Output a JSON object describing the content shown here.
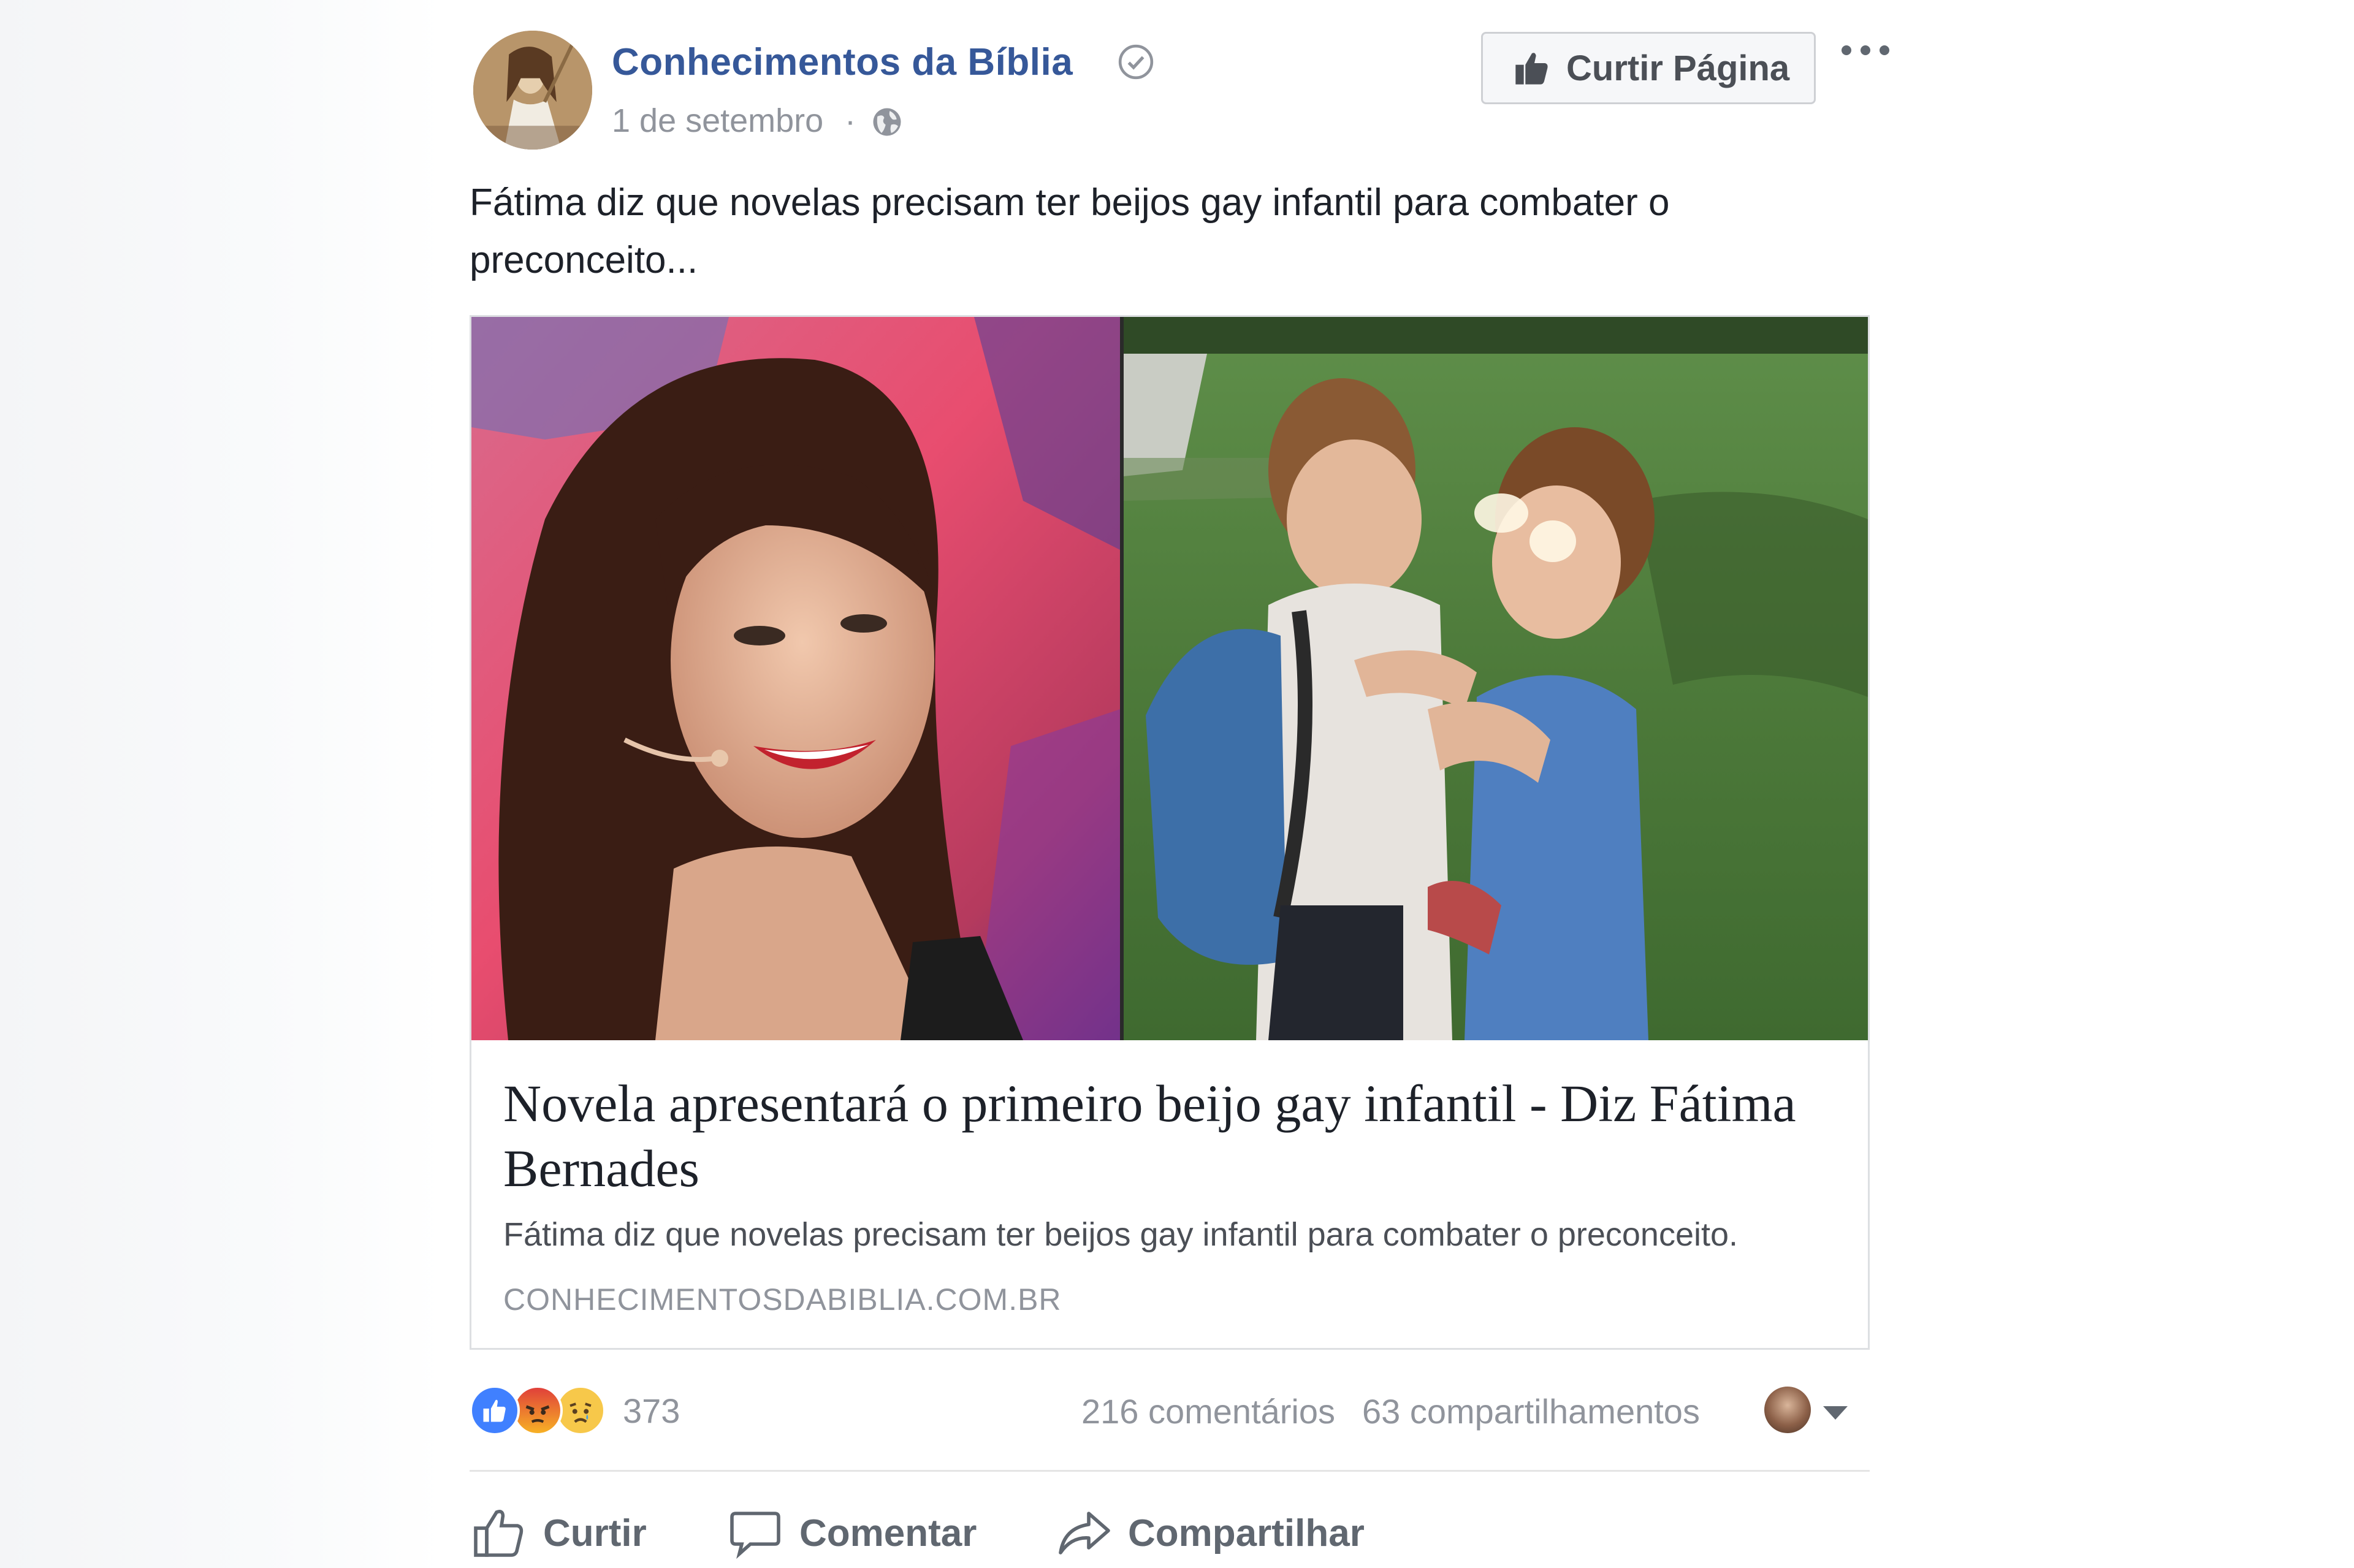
{
  "post": {
    "page_name": "Conhecimentos da Bíblia",
    "date": "1 de setembro",
    "separator": "·",
    "like_page_label": "Curtir Página",
    "text": "Fátima diz que novelas precisam ter beijos gay infantil para combater o preconceito..."
  },
  "link_preview": {
    "title": "Novela apresentará o primeiro beijo gay infantil - Diz Fátima Bernades",
    "description": "Fátima diz que novelas precisam ter beijos gay infantil para combater o preconceito.",
    "domain": "CONHECIMENTOSDABIBLIA.COM.BR"
  },
  "stats": {
    "reactions_count": "373",
    "reaction_icons": [
      "like",
      "angry",
      "sad"
    ],
    "comments": "216 comentários",
    "shares": "63 compartilhamentos"
  },
  "actions": {
    "like": "Curtir",
    "comment": "Comentar",
    "share": "Compartilhar"
  },
  "colors": {
    "link": "#365899",
    "muted": "#90949c",
    "text": "#1d2129",
    "like_blue": "#4080ff",
    "angry_red": "#e9710f",
    "sad_yellow": "#f7b125"
  }
}
